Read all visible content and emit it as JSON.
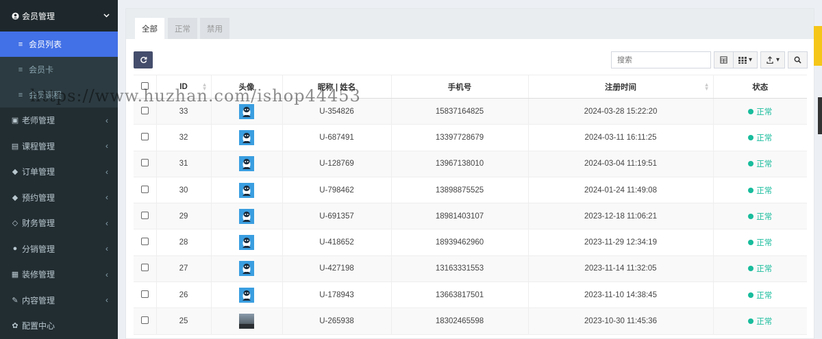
{
  "sidebar": {
    "group": {
      "label": "会员管理",
      "icon": "user-circle-icon"
    },
    "sub_items": [
      {
        "label": "会员列表",
        "icon": "list-icon",
        "active": true
      },
      {
        "label": "会员卡",
        "icon": "list-icon",
        "active": false
      },
      {
        "label": "会员课程",
        "icon": "list-icon",
        "active": false
      }
    ],
    "items": [
      {
        "label": "老师管理",
        "icon": "teacher-icon"
      },
      {
        "label": "课程管理",
        "icon": "course-icon"
      },
      {
        "label": "订单管理",
        "icon": "order-icon"
      },
      {
        "label": "预约管理",
        "icon": "booking-icon"
      },
      {
        "label": "财务管理",
        "icon": "diamond-icon"
      },
      {
        "label": "分销管理",
        "icon": "users-icon"
      },
      {
        "label": "装修管理",
        "icon": "design-icon"
      },
      {
        "label": "内容管理",
        "icon": "edit-icon"
      },
      {
        "label": "配置中心",
        "icon": "gear-icon"
      }
    ]
  },
  "tabs": [
    "全部",
    "正常",
    "禁用"
  ],
  "toolbar": {
    "search_placeholder": "搜索"
  },
  "table": {
    "headers": [
      "ID",
      "头像",
      "昵称 | 姓名",
      "手机号",
      "注册时间",
      "状态"
    ],
    "rows": [
      {
        "id": "33",
        "nickname": "U-354826",
        "phone": "15837164825",
        "registered": "2024-03-28 15:22:20",
        "status": "正常"
      },
      {
        "id": "32",
        "nickname": "U-687491",
        "phone": "13397728679",
        "registered": "2024-03-11 16:11:25",
        "status": "正常"
      },
      {
        "id": "31",
        "nickname": "U-128769",
        "phone": "13967138010",
        "registered": "2024-03-04 11:19:51",
        "status": "正常"
      },
      {
        "id": "30",
        "nickname": "U-798462",
        "phone": "13898875525",
        "registered": "2024-01-24 11:49:08",
        "status": "正常"
      },
      {
        "id": "29",
        "nickname": "U-691357",
        "phone": "18981403107",
        "registered": "2023-12-18 11:06:21",
        "status": "正常"
      },
      {
        "id": "28",
        "nickname": "U-418652",
        "phone": "18939462960",
        "registered": "2023-11-29 12:34:19",
        "status": "正常"
      },
      {
        "id": "27",
        "nickname": "U-427198",
        "phone": "13163331553",
        "registered": "2023-11-14 11:32:05",
        "status": "正常"
      },
      {
        "id": "26",
        "nickname": "U-178943",
        "phone": "13663817501",
        "registered": "2023-11-10 14:38:45",
        "status": "正常"
      },
      {
        "id": "25",
        "nickname": "U-265938",
        "phone": "18302465598",
        "registered": "2023-10-30 11:45:36",
        "status": "正常"
      }
    ]
  },
  "colors": {
    "sidebar_bg": "#222d32",
    "active_item": "#4270e6",
    "status_green": "#18bc9c",
    "refresh_btn": "#444d6b"
  },
  "watermark": "https://www.huzhan.com/ishop44453"
}
